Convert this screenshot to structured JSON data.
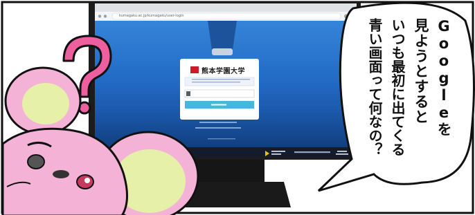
{
  "speech_bubble": {
    "lines": [
      "Googleを",
      "見ようとすると",
      "いつも最初に出てくる",
      "青い画面って何なの？"
    ]
  },
  "browser": {
    "address_bar": "kumagaku.ac.jp/kumagaku/user-login"
  },
  "login_screen": {
    "university_name": "熊本学園大学"
  },
  "colors": {
    "screen_blue": "#2f7fd6",
    "screen_deep": "#123b75",
    "mouse_pink": "#f4b3d6",
    "ear_lime": "#e6f0a8",
    "question_pink": "#ee5fa0",
    "university_red": "#c81e2a"
  }
}
